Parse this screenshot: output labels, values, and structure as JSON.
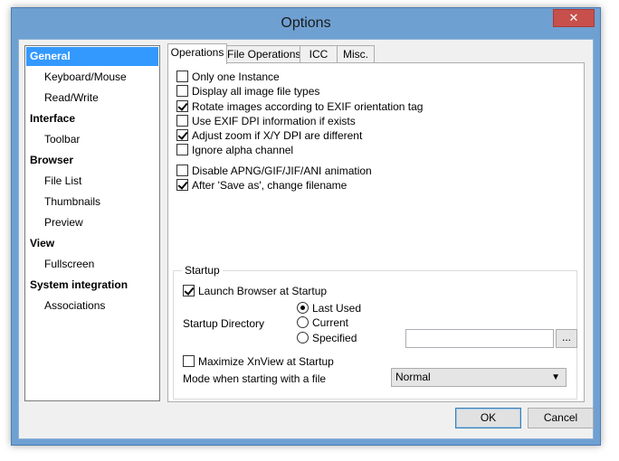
{
  "window": {
    "title": "Options",
    "close_glyph": "✕"
  },
  "nav": {
    "items": [
      {
        "label": "General",
        "type": "cat"
      },
      {
        "label": "Keyboard/Mouse",
        "type": "sub"
      },
      {
        "label": "Read/Write",
        "type": "sub"
      },
      {
        "label": "Interface",
        "type": "cat"
      },
      {
        "label": "Toolbar",
        "type": "sub"
      },
      {
        "label": "Browser",
        "type": "cat"
      },
      {
        "label": "File List",
        "type": "sub"
      },
      {
        "label": "Thumbnails",
        "type": "sub"
      },
      {
        "label": "Preview",
        "type": "sub"
      },
      {
        "label": "View",
        "type": "cat"
      },
      {
        "label": "Fullscreen",
        "type": "sub"
      },
      {
        "label": "System integration",
        "type": "cat"
      },
      {
        "label": "Associations",
        "type": "sub"
      }
    ],
    "selected": "General"
  },
  "tabs": [
    "Operations",
    "File Operations",
    "ICC",
    "Misc."
  ],
  "active_tab": "Operations",
  "options": [
    {
      "label": "Only one Instance",
      "checked": false
    },
    {
      "label": "Display all image file types",
      "checked": false
    },
    {
      "label": "Rotate images according to EXIF orientation tag",
      "checked": true
    },
    {
      "label": "Use EXIF DPI information if exists",
      "checked": false
    },
    {
      "label": "Adjust zoom if X/Y DPI are different",
      "checked": true
    },
    {
      "label": "Ignore alpha channel",
      "checked": false
    },
    {
      "label": "Disable APNG/GIF/JIF/ANI animation",
      "checked": false
    },
    {
      "label": "After 'Save as', change filename",
      "checked": true
    }
  ],
  "startup": {
    "legend": "Startup",
    "launch_browser": {
      "label": "Launch Browser at Startup",
      "checked": true
    },
    "directory_label": "Startup Directory",
    "directory_options": [
      "Last Used",
      "Current",
      "Specified"
    ],
    "directory_selected": "Last Used",
    "specified_path": "",
    "browse_label": "...",
    "maximize": {
      "label": "Maximize XnView at Startup",
      "checked": false
    },
    "mode_label": "Mode when starting with a file",
    "mode_value": "Normal"
  },
  "buttons": {
    "ok": "OK",
    "cancel": "Cancel"
  }
}
